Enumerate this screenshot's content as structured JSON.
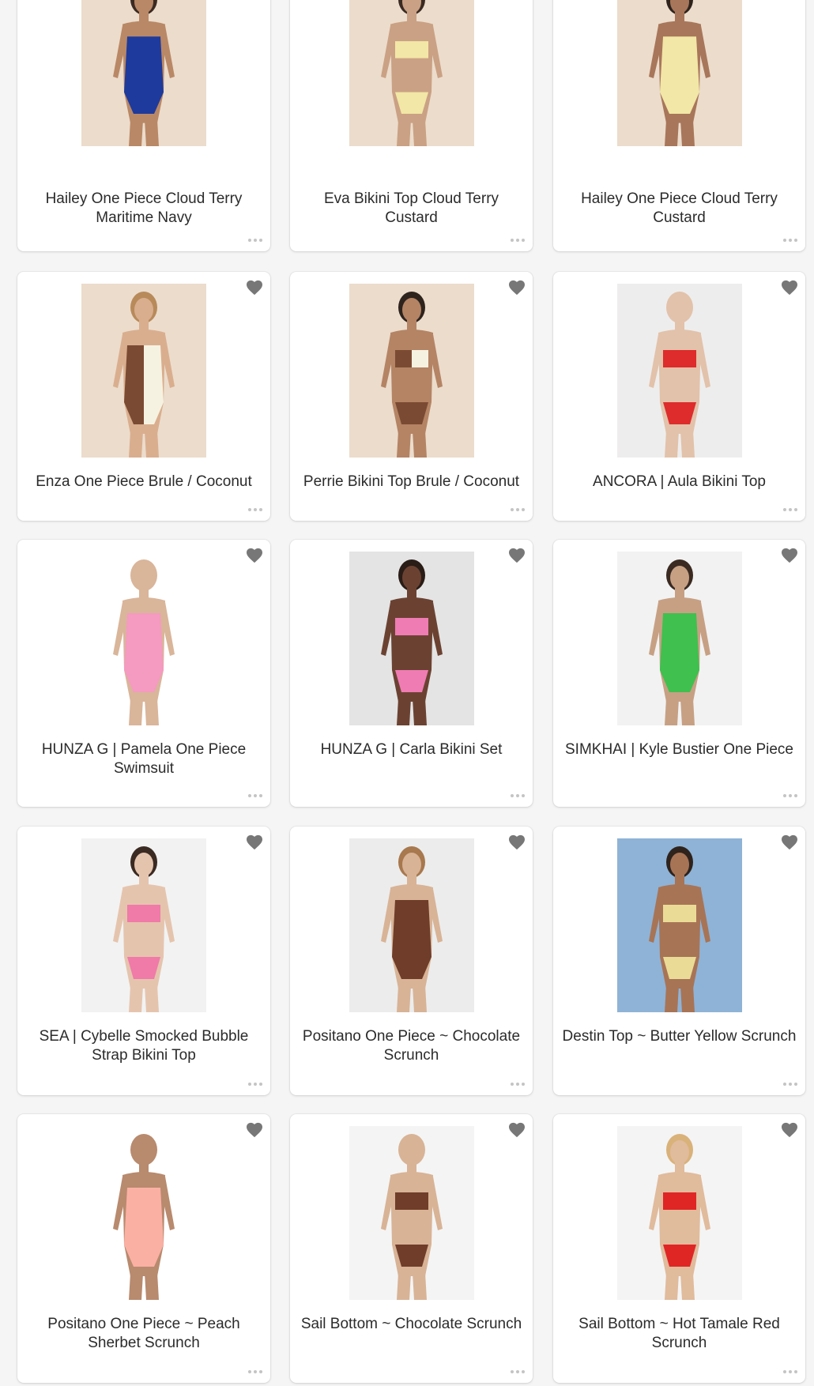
{
  "products": [
    {
      "title": "Hailey One Piece Cloud Terry Maritime Navy",
      "colors": {
        "bg": "#ecdccc",
        "skin": "#b98866",
        "hair": "#3a2a22",
        "suit": "#1e3a9c"
      },
      "style": "onepiece",
      "icons": {
        "favorite": "heart-icon",
        "more": "more-dots-icon"
      }
    },
    {
      "title": "Eva Bikini Top Cloud Terry Custard",
      "colors": {
        "bg": "#ecdccc",
        "skin": "#caa184",
        "hair": "#3a2a22",
        "suit": "#f2e7a6"
      },
      "style": "bikini",
      "icons": {
        "favorite": "heart-icon",
        "more": "more-dots-icon"
      }
    },
    {
      "title": "Hailey One Piece Cloud Terry Custard",
      "colors": {
        "bg": "#ecdccc",
        "skin": "#a8765a",
        "hair": "#2e231d",
        "suit": "#f2e7a6"
      },
      "style": "onepiece",
      "icons": {
        "favorite": "heart-icon",
        "more": "more-dots-icon"
      }
    },
    {
      "title": "Enza One Piece Brule / Coconut",
      "colors": {
        "bg": "#ecdccc",
        "skin": "#d9ae8e",
        "hair": "#b88a5a",
        "suit": "#7b4a32",
        "suit2": "#f6f2e2"
      },
      "style": "twotone",
      "icons": {
        "favorite": "heart-icon",
        "more": "more-dots-icon"
      }
    },
    {
      "title": "Perrie Bikini Top Brule / Coconut",
      "colors": {
        "bg": "#ecdccc",
        "skin": "#b48465",
        "hair": "#2e231d",
        "suit": "#7b4a32",
        "suit2": "#f6f2e2"
      },
      "style": "bikini",
      "icons": {
        "favorite": "heart-icon",
        "more": "more-dots-icon"
      }
    },
    {
      "title": "ANCORA | Aula Bikini Top",
      "colors": {
        "bg": "#eeeded",
        "skin": "#e2c2aa",
        "hair": "#e2c2aa",
        "suit": "#de2b2b"
      },
      "style": "bikini",
      "icons": {
        "favorite": "heart-icon",
        "more": "more-dots-icon"
      }
    },
    {
      "title": "HUNZA G | Pamela One Piece Swimsuit",
      "colors": {
        "bg": "#ffffff",
        "skin": "#d9b59a",
        "hair": "#d9b59a",
        "suit": "#f59ac0"
      },
      "style": "onepiece",
      "icons": {
        "favorite": "heart-icon",
        "more": "more-dots-icon"
      }
    },
    {
      "title": "HUNZA G | Carla Bikini Set",
      "colors": {
        "bg": "#e4e4e4",
        "skin": "#6b4232",
        "hair": "#2a1c16",
        "suit": "#f07cb4"
      },
      "style": "bikini",
      "icons": {
        "favorite": "heart-icon",
        "more": "more-dots-icon"
      }
    },
    {
      "title": "SIMKHAI | Kyle Bustier One Piece",
      "colors": {
        "bg": "#f2f2f2",
        "skin": "#c7a084",
        "hair": "#3a2a22",
        "suit": "#3fc04f"
      },
      "style": "onepiece",
      "icons": {
        "favorite": "heart-icon",
        "more": "more-dots-icon"
      }
    },
    {
      "title": "SEA | Cybelle Smocked Bubble Strap Bikini Top",
      "colors": {
        "bg": "#f2f2f2",
        "skin": "#e5c4ae",
        "hair": "#3a2a22",
        "suit": "#f07aa8"
      },
      "style": "bikini",
      "icons": {
        "favorite": "heart-icon",
        "more": "more-dots-icon"
      }
    },
    {
      "title": "Positano One Piece ~ Chocolate Scrunch",
      "colors": {
        "bg": "#ececec",
        "skin": "#d8b396",
        "hair": "#a8784e",
        "suit": "#6f3d2a"
      },
      "style": "onepiece",
      "icons": {
        "favorite": "heart-icon",
        "more": "more-dots-icon"
      }
    },
    {
      "title": "Destin Top ~ Butter Yellow Scrunch",
      "colors": {
        "bg": "#8fb3d6",
        "skin": "#a87456",
        "hair": "#2e231d",
        "suit": "#eadc96"
      },
      "style": "bikini",
      "icons": {
        "favorite": "heart-icon",
        "more": "more-dots-icon"
      }
    },
    {
      "title": "Positano One Piece ~ Peach Sherbet Scrunch",
      "colors": {
        "bg": "#ffffff",
        "skin": "#b88a6e",
        "hair": "#b88a6e",
        "suit": "#fbb0a4"
      },
      "style": "onepiece",
      "icons": {
        "favorite": "heart-icon",
        "more": "more-dots-icon"
      }
    },
    {
      "title": "Sail Bottom ~ Chocolate Scrunch",
      "colors": {
        "bg": "#f4f4f4",
        "skin": "#d8b396",
        "hair": "#d8b396",
        "suit": "#6f3d2a"
      },
      "style": "bikini",
      "icons": {
        "favorite": "heart-icon",
        "more": "more-dots-icon"
      }
    },
    {
      "title": "Sail Bottom ~ Hot Tamale Red Scrunch",
      "colors": {
        "bg": "#f4f4f4",
        "skin": "#e0bb9c",
        "hair": "#d9b27a",
        "suit": "#e02525"
      },
      "style": "bikini",
      "icons": {
        "favorite": "heart-icon",
        "more": "more-dots-icon"
      }
    }
  ]
}
